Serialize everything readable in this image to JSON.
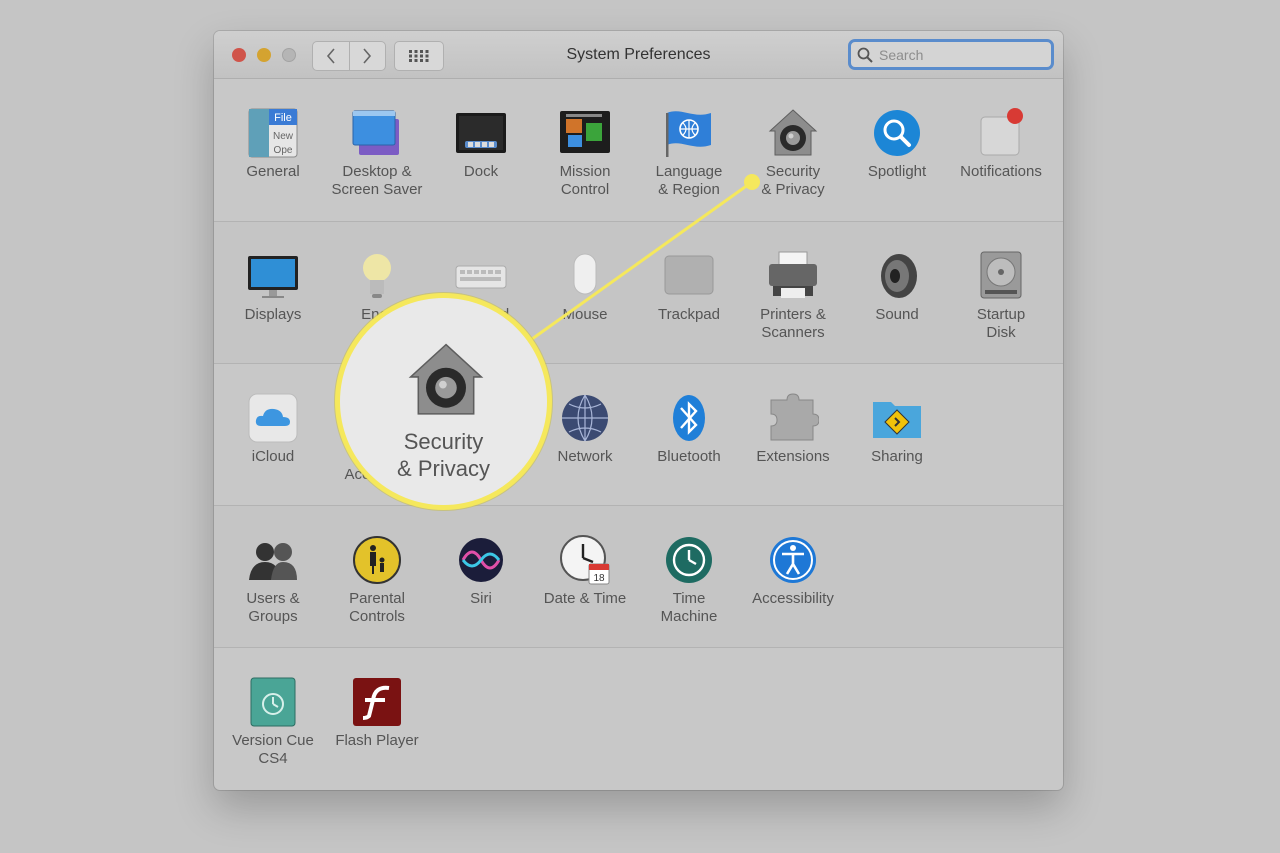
{
  "window": {
    "title": "System Preferences",
    "search_placeholder": "Search"
  },
  "sections": [
    {
      "items": [
        {
          "label": "General",
          "icon": "general-icon"
        },
        {
          "label": "Desktop &\nScreen Saver",
          "icon": "desktop-icon"
        },
        {
          "label": "Dock",
          "icon": "dock-icon"
        },
        {
          "label": "Mission\nControl",
          "icon": "mission-control-icon"
        },
        {
          "label": "Language\n& Region",
          "icon": "flag-icon"
        },
        {
          "label": "Security\n& Privacy",
          "icon": "house-lock-icon"
        },
        {
          "label": "Spotlight",
          "icon": "magnifier-icon"
        },
        {
          "label": "Notifications",
          "icon": "notifications-icon"
        }
      ]
    },
    {
      "items": [
        {
          "label": "Displays",
          "icon": "display-icon"
        },
        {
          "label": "Ener",
          "icon": "lightbulb-icon"
        },
        {
          "label": "d",
          "icon": "keyboard-icon"
        },
        {
          "label": "Mouse",
          "icon": "mouse-icon"
        },
        {
          "label": "Trackpad",
          "icon": "trackpad-icon"
        },
        {
          "label": "Printers &\nScanners",
          "icon": "printer-icon"
        },
        {
          "label": "Sound",
          "icon": "speaker-icon"
        },
        {
          "label": "Startup\nDisk",
          "icon": "disk-icon"
        }
      ]
    },
    {
      "items": [
        {
          "label": "iCloud",
          "icon": "cloud-icon"
        },
        {
          "label": "Acc",
          "icon": "accounts-icon"
        },
        {
          "label": "Network",
          "icon": "globe-icon"
        },
        {
          "label": "Bluetooth",
          "icon": "bluetooth-icon"
        },
        {
          "label": "Extensions",
          "icon": "puzzle-icon"
        },
        {
          "label": "Sharing",
          "icon": "folder-icon"
        }
      ]
    },
    {
      "items": [
        {
          "label": "Users &\nGroups",
          "icon": "users-icon"
        },
        {
          "label": "Parental\nControls",
          "icon": "parental-icon"
        },
        {
          "label": "Siri",
          "icon": "siri-icon"
        },
        {
          "label": "Date & Time",
          "icon": "clock-icon"
        },
        {
          "label": "Time\nMachine",
          "icon": "time-machine-icon"
        },
        {
          "label": "Accessibility",
          "icon": "accessibility-icon"
        }
      ]
    },
    {
      "items": [
        {
          "label": "Version Cue\nCS4",
          "icon": "version-cue-icon"
        },
        {
          "label": "Flash Player",
          "icon": "flash-icon"
        }
      ]
    }
  ],
  "callout": {
    "label": "Security\n& Privacy",
    "icon": "house-lock-icon",
    "highlight_color": "#f5e85c"
  },
  "colors": {
    "close": "#d0544a",
    "minimize": "#d4a330",
    "search_focus": "#5a8ccc"
  }
}
